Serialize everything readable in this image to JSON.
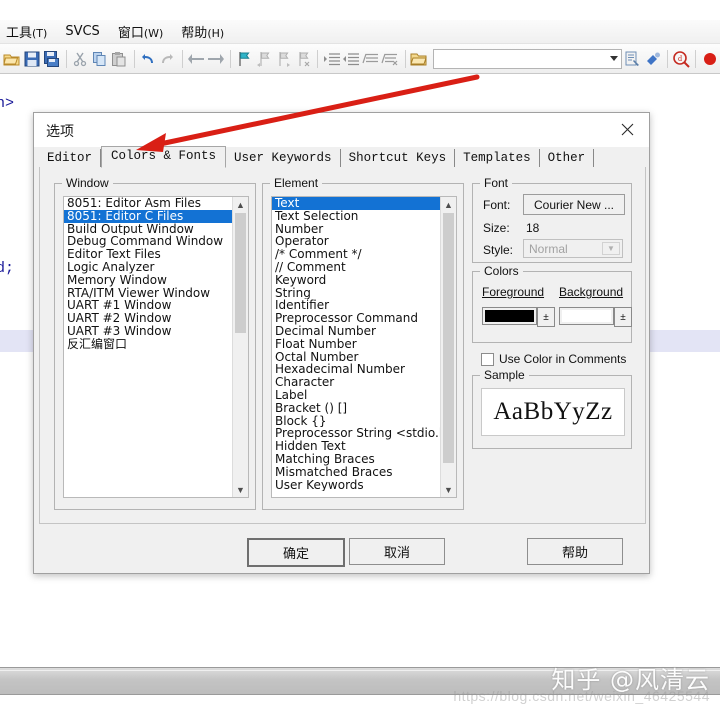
{
  "app": {
    "menubar": [
      {
        "label": "工具",
        "mnemonic": "(T)",
        "name": "menu-tools"
      },
      {
        "label": "SVCS",
        "mnemonic": "",
        "name": "menu-svcs"
      },
      {
        "label": "窗口",
        "mnemonic": "(W)",
        "name": "menu-window"
      },
      {
        "label": "帮助",
        "mnemonic": "(H)",
        "name": "menu-help"
      }
    ],
    "toolbar": {
      "combo_value": "",
      "icons": [
        "open-folder-icon",
        "save-icon",
        "save-all-icon",
        "cut-icon",
        "copy-icon",
        "paste-icon",
        "undo-icon",
        "redo-icon",
        "back-icon",
        "forward-icon",
        "bookmark-toggle-icon",
        "bookmark-prev-icon",
        "bookmark-next-icon",
        "bookmark-clear-icon",
        "indent-icon",
        "outdent-icon",
        "comment-icon",
        "uncomment-icon",
        "open-project-icon",
        "build-icon",
        "debug-icon",
        "find-in-files-icon",
        "record-icon"
      ]
    },
    "editor": {
      "line1": "h>",
      "line2": "d;"
    },
    "watermark": {
      "text": "知乎 @风清云",
      "url": "https://blog.csdn.net/weixin_46425544"
    }
  },
  "dialog": {
    "title": "选项",
    "close_label": "✕",
    "tabs": [
      {
        "label": "Editor",
        "active": false
      },
      {
        "label": "Colors & Fonts",
        "active": true
      },
      {
        "label": "User Keywords",
        "active": false
      },
      {
        "label": "Shortcut Keys",
        "active": false
      },
      {
        "label": "Templates",
        "active": false
      },
      {
        "label": "Other",
        "active": false
      }
    ],
    "window_group": {
      "legend": "Window",
      "items": [
        {
          "label": "8051: Editor Asm Files",
          "selected": false
        },
        {
          "label": "8051: Editor C Files",
          "selected": true
        },
        {
          "label": "Build Output Window",
          "selected": false
        },
        {
          "label": "Debug Command Window",
          "selected": false
        },
        {
          "label": "Editor Text Files",
          "selected": false
        },
        {
          "label": "Logic Analyzer",
          "selected": false
        },
        {
          "label": "Memory Window",
          "selected": false
        },
        {
          "label": "RTA/ITM Viewer Window",
          "selected": false
        },
        {
          "label": "UART #1 Window",
          "selected": false
        },
        {
          "label": "UART #2 Window",
          "selected": false
        },
        {
          "label": "UART #3 Window",
          "selected": false
        },
        {
          "label": "反汇编窗口",
          "selected": false
        }
      ]
    },
    "element_group": {
      "legend": "Element",
      "items": [
        {
          "label": "Text",
          "selected": true
        },
        {
          "label": "Text Selection",
          "selected": false
        },
        {
          "label": "Number",
          "selected": false
        },
        {
          "label": "Operator",
          "selected": false
        },
        {
          "label": "/* Comment */",
          "selected": false
        },
        {
          "label": "// Comment",
          "selected": false
        },
        {
          "label": "Keyword",
          "selected": false
        },
        {
          "label": "String",
          "selected": false
        },
        {
          "label": "Identifier",
          "selected": false
        },
        {
          "label": "Preprocessor Command",
          "selected": false
        },
        {
          "label": "Decimal Number",
          "selected": false
        },
        {
          "label": "Float Number",
          "selected": false
        },
        {
          "label": "Octal Number",
          "selected": false
        },
        {
          "label": "Hexadecimal Number",
          "selected": false
        },
        {
          "label": "Character",
          "selected": false
        },
        {
          "label": "Label",
          "selected": false
        },
        {
          "label": "Bracket () []",
          "selected": false
        },
        {
          "label": "Block {}",
          "selected": false
        },
        {
          "label": "Preprocessor String <stdio.h>",
          "selected": false
        },
        {
          "label": "Hidden Text",
          "selected": false
        },
        {
          "label": "Matching Braces",
          "selected": false
        },
        {
          "label": "Mismatched Braces",
          "selected": false
        },
        {
          "label": "User Keywords",
          "selected": false
        }
      ]
    },
    "font_group": {
      "legend": "Font",
      "font_label": "Font:",
      "font_value": "Courier New ...",
      "size_label": "Size:",
      "size_value": "18",
      "style_label": "Style:",
      "style_value": "Normal"
    },
    "colors_group": {
      "legend": "Colors",
      "foreground_label": "Foreground",
      "background_label": "Background",
      "foreground_color": "#000000",
      "background_color": "#ffffff",
      "dropdown_glyph": "±"
    },
    "use_color_checkbox": {
      "label": "Use Color in Comments",
      "checked": false
    },
    "sample_group": {
      "legend": "Sample",
      "text": "AaBbYyZz"
    },
    "buttons": [
      {
        "label": "确定",
        "name": "ok-button",
        "default": true
      },
      {
        "label": "取消",
        "name": "cancel-button",
        "default": false
      },
      {
        "label": "帮助",
        "name": "help-button",
        "default": false
      }
    ]
  },
  "annotation": {
    "arrow_color": "#d91f15"
  }
}
